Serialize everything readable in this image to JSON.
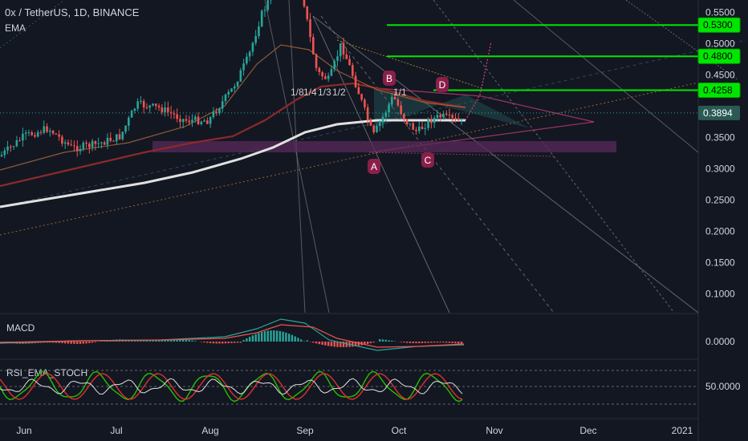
{
  "header": {
    "symbol": "0x / TetherUS, 1D, BINANCE",
    "indicator": "EMA"
  },
  "panes": {
    "macd_label": "MACD",
    "stoch_label": "RSI_EMA_STOCH"
  },
  "colors": {
    "background": "#131722",
    "up": "#26a69a",
    "down": "#ef5350",
    "green_level": "#00e600",
    "ema_white": "#e0e0e0",
    "ema_red": "#8b2a2a",
    "pink": "#d0407a",
    "purple_zone": "#5a2a5a"
  },
  "chart_data": {
    "type": "candlestick",
    "y_axis": {
      "ticks": [
        0.55,
        0.5,
        0.45,
        0.35,
        0.3,
        0.25,
        0.2,
        0.15,
        0.1
      ],
      "labels": [
        "0.5500",
        "0.5000",
        "0.4500",
        "0.3500",
        "0.3000",
        "0.2500",
        "0.2000",
        "0.1500",
        "0.1000"
      ],
      "range": [
        0.07,
        0.57
      ]
    },
    "x_axis": {
      "labels": [
        "Jun",
        "Jul",
        "Aug",
        "Sep",
        "Oct",
        "Nov",
        "Dec",
        "2021"
      ]
    },
    "price_labels": [
      {
        "value": 0.53,
        "text": "0.5300",
        "kind": "level"
      },
      {
        "value": 0.48,
        "text": "0.4800",
        "kind": "level"
      },
      {
        "value": 0.4258,
        "text": "0.4258",
        "kind": "level"
      },
      {
        "value": 0.3894,
        "text": "0.3894",
        "kind": "current"
      }
    ],
    "pattern_points": [
      {
        "label": "A",
        "date": "2020-09-22",
        "price": 0.335
      },
      {
        "label": "B",
        "date": "2020-09-27",
        "price": 0.47
      },
      {
        "label": "C",
        "date": "2020-10-08",
        "price": 0.345
      },
      {
        "label": "D",
        "date": "2020-10-13",
        "price": 0.423
      }
    ],
    "fib_labels": [
      "1/8",
      "1/4",
      "1/3",
      "1/2",
      "1/1"
    ],
    "macd": {
      "label": "MACD",
      "tick": "0.0000"
    },
    "stoch": {
      "label": "RSI_EMA_STOCH",
      "tick": "50.0000"
    }
  }
}
